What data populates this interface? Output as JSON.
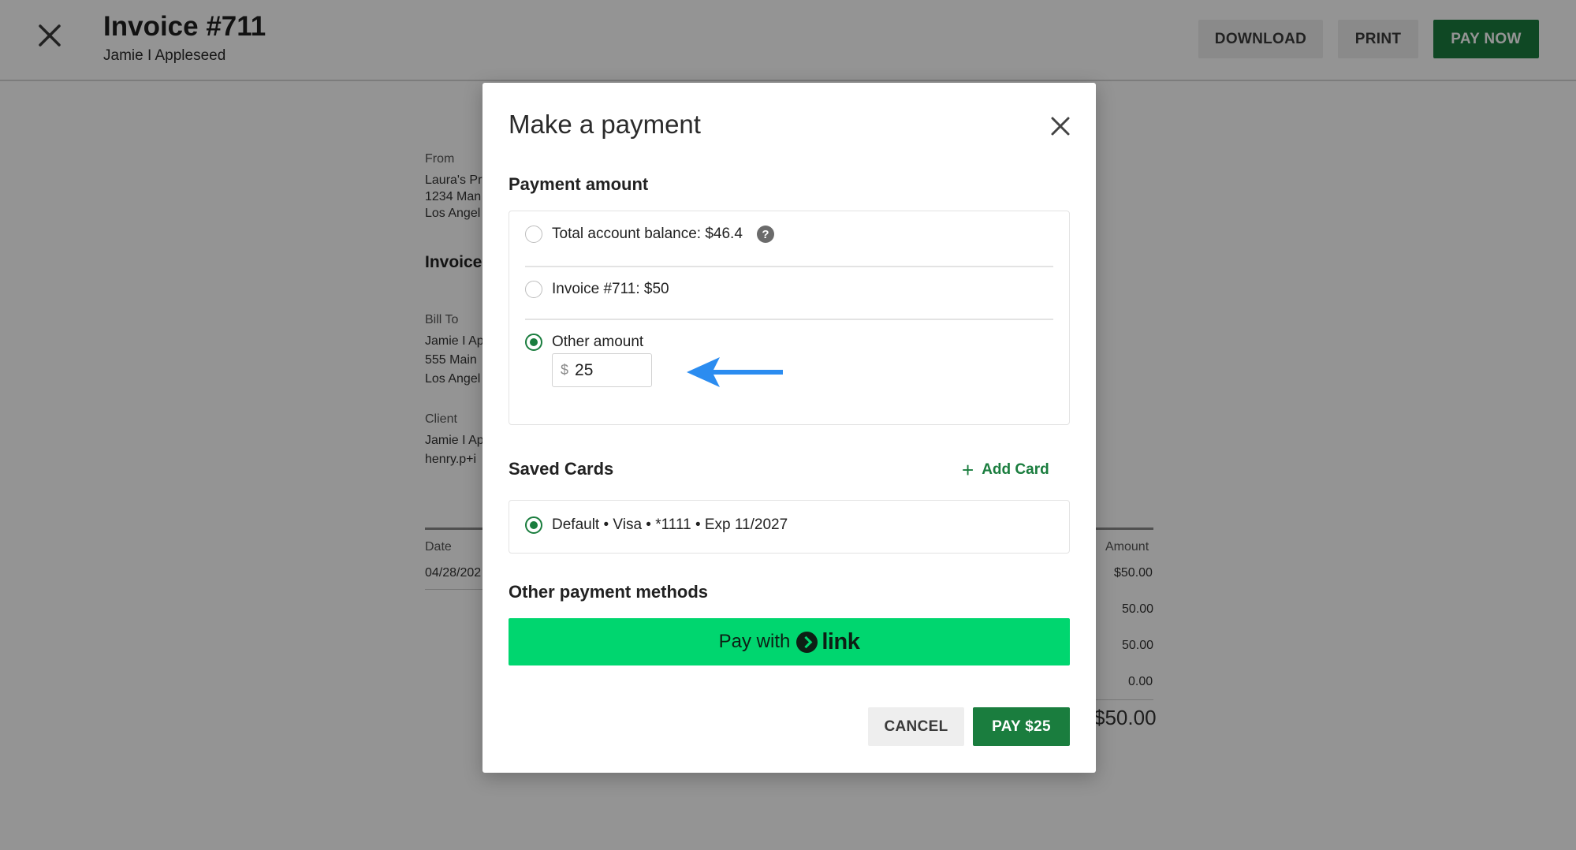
{
  "header": {
    "title": "Invoice #711",
    "subtitle": "Jamie I Appleseed",
    "download_label": "DOWNLOAD",
    "print_label": "PRINT",
    "pay_now_label": "PAY NOW"
  },
  "document": {
    "from_label": "From",
    "from_lines": [
      "Laura's Pr",
      "1234 Man",
      "Los Angel"
    ],
    "invoice_heading": "Invoice",
    "bill_to_label": "Bill To",
    "bill_to_lines": [
      "Jamie I Ap",
      "555 Main",
      "Los Angel"
    ],
    "client_label": "Client",
    "client_lines": [
      "Jamie I Ap",
      "henry.p+i"
    ],
    "table": {
      "date_header": "Date",
      "date_value": "04/28/202",
      "amount_header": "Amount",
      "amounts": [
        "$50.00",
        "50.00",
        "50.00",
        "0.00"
      ],
      "total": "$50.00"
    }
  },
  "modal": {
    "title": "Make a payment",
    "payment_amount_title": "Payment amount",
    "options": [
      {
        "label": "Total account balance: $46.4",
        "selected": false
      },
      {
        "label": "Invoice #711: $50",
        "selected": false
      },
      {
        "label": "Other amount",
        "selected": true
      }
    ],
    "help_glyph": "?",
    "other_amount": {
      "currency": "$",
      "value": "25"
    },
    "saved_cards_title": "Saved Cards",
    "add_card_label": "Add Card",
    "add_card_glyph": "+",
    "saved_card": {
      "label": "Default • Visa • *1111 • Exp 11/2027",
      "selected": true
    },
    "other_methods_title": "Other payment methods",
    "link_button": {
      "prefix": "Pay with",
      "brand": "link"
    },
    "cancel_label": "CANCEL",
    "pay_label": "PAY $25"
  },
  "colors": {
    "accent_green": "#1a7d3e",
    "link_green": "#00d66f",
    "annotation_arrow": "#2b8cf0"
  }
}
